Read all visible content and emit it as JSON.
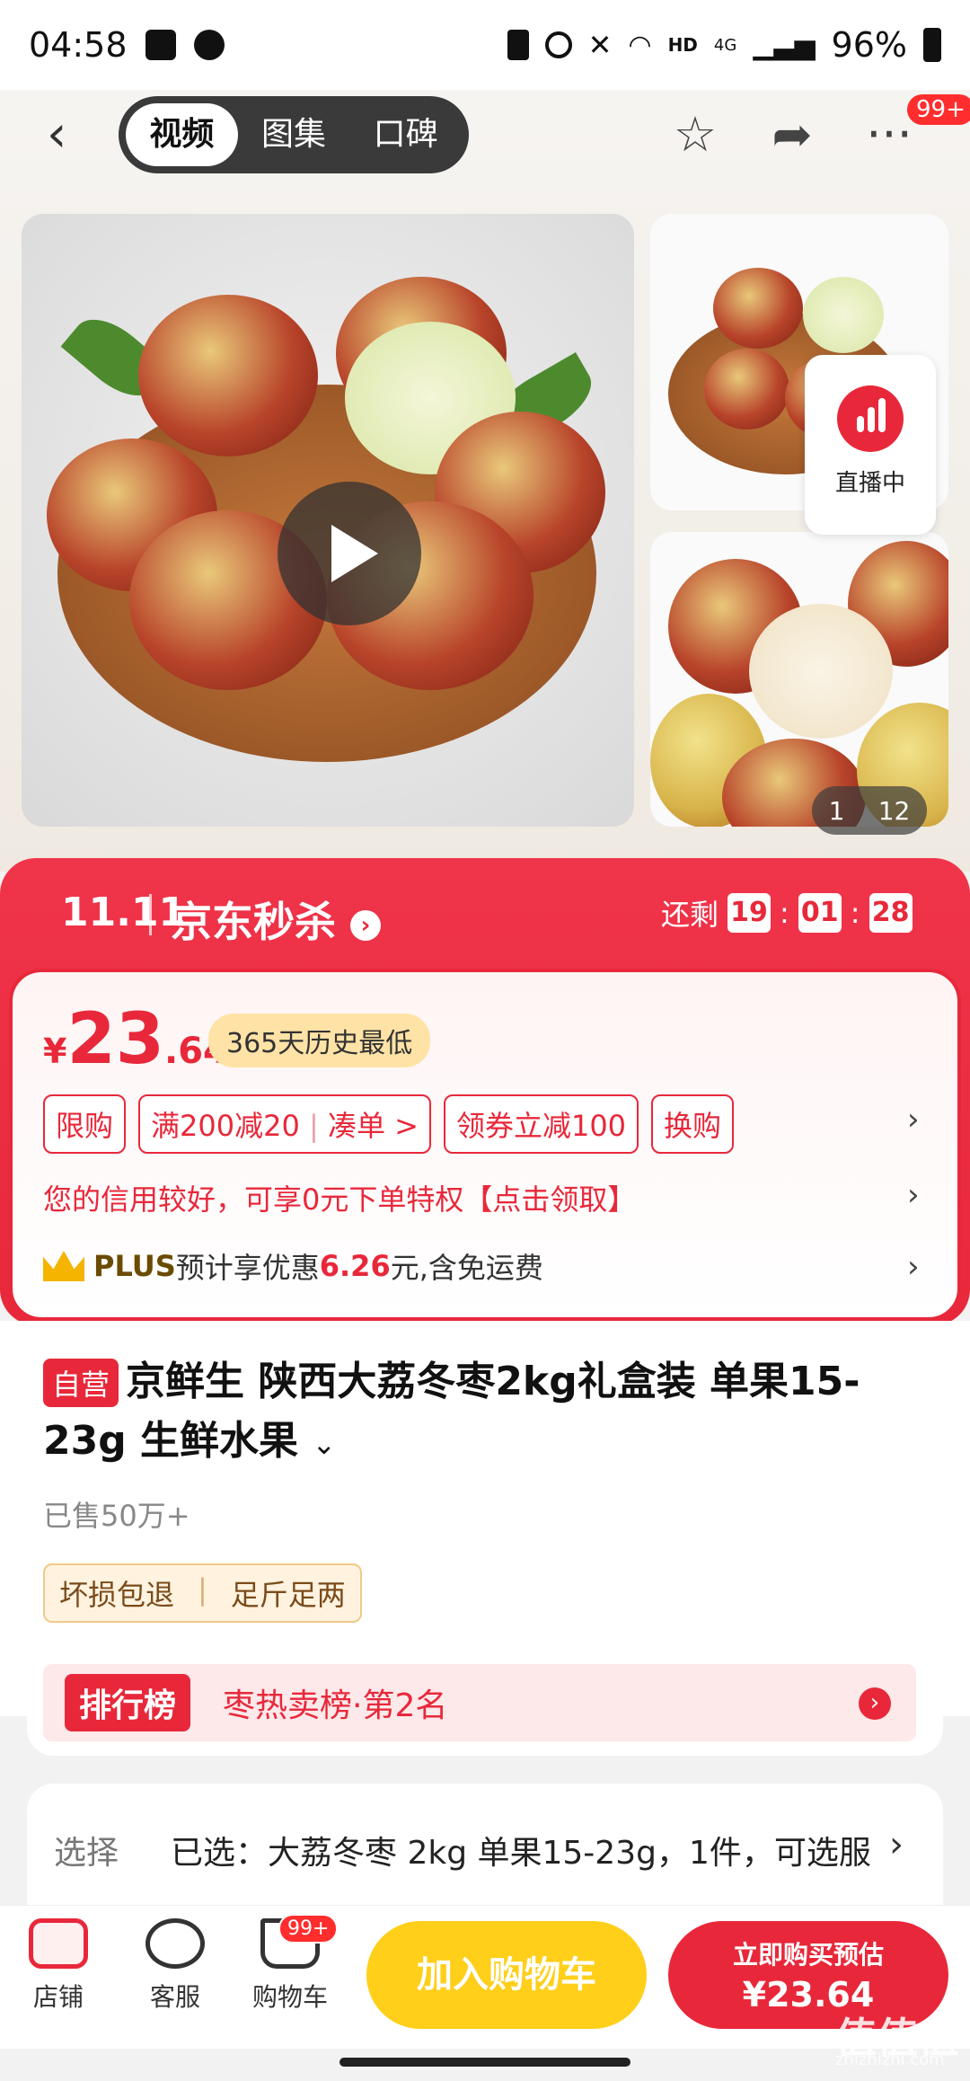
{
  "status_bar": {
    "time": "04:58",
    "battery": "96%",
    "network": "4G",
    "hd": "HD"
  },
  "top_nav": {
    "tabs": [
      "视频",
      "图集",
      "口碑"
    ],
    "active_tab": "视频",
    "more_badge": "99+"
  },
  "gallery": {
    "live_label": "直播中",
    "current_index": "1",
    "total": "12"
  },
  "promo": {
    "double11_logo": "11.11",
    "brand": "京东秒杀",
    "remaining_label": "还剩",
    "countdown": [
      "19",
      "01",
      "28"
    ]
  },
  "price": {
    "currency": "¥",
    "integer": "23",
    "decimal": ".64",
    "history_label": "365天历史最低"
  },
  "tags": [
    "限购",
    "满200减20",
    "凑单 >",
    "领券立减100",
    "换购"
  ],
  "credit_text": "您的信用较好，可享0元下单特权【点击领取】",
  "plus": {
    "brand": "PLUS",
    "text_before": "预计享优惠",
    "amount": "6.26",
    "text_after": "元,含免运费"
  },
  "product": {
    "self_operated": "自营",
    "title": "京鲜生 陕西大荔冬枣2kg礼盒装 单果15-23g 生鲜水果",
    "sold": "已售50万+",
    "guarantees": [
      "坏损包退",
      "足斤足两"
    ]
  },
  "ranking": {
    "badge": "排行榜",
    "text": "枣热卖榜·第2名"
  },
  "selection": {
    "label": "选择",
    "text": "已选：大荔冬枣 2kg 单果15-23g，1件，可选服务"
  },
  "bottom_bar": {
    "shop": "店铺",
    "service": "客服",
    "cart": "购物车",
    "cart_badge": "99+",
    "add_to_cart": "加入购物车",
    "buy_now_line1": "立即购买预估",
    "buy_now_price": "¥23.64"
  },
  "watermark": {
    "logo": "值值值",
    "site": "zhizhizhi.com"
  },
  "colors": {
    "brand_red": "#e8283a",
    "cart_yellow": "#ffcf1a"
  }
}
